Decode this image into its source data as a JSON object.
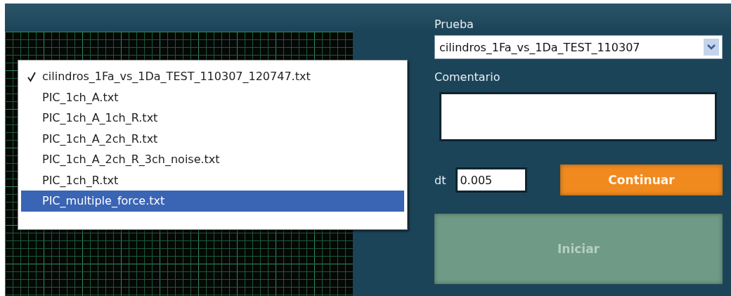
{
  "plot": {
    "dropdown_menu": {
      "items": [
        {
          "label": "cilindros_1Fa_vs_1Da_TEST_110307_120747.txt",
          "checked": true,
          "selected": false
        },
        {
          "label": "PIC_1ch_A.txt",
          "checked": false,
          "selected": false
        },
        {
          "label": "PIC_1ch_A_1ch_R.txt",
          "checked": false,
          "selected": false
        },
        {
          "label": "PIC_1ch_A_2ch_R.txt",
          "checked": false,
          "selected": false
        },
        {
          "label": "PIC_1ch_A_2ch_R_3ch_noise.txt",
          "checked": false,
          "selected": false
        },
        {
          "label": "PIC_1ch_R.txt",
          "checked": false,
          "selected": false
        },
        {
          "label": "PIC_multiple_force.txt",
          "checked": false,
          "selected": true
        }
      ]
    }
  },
  "panel": {
    "prueba": {
      "label": "Prueba",
      "value": "cilindros_1Fa_vs_1Da_TEST_110307"
    },
    "comentario": {
      "label": "Comentario"
    },
    "dt": {
      "label": "dt",
      "value": "0.005"
    },
    "continuar": {
      "label": "Continuar",
      "disabled": false
    },
    "iniciar": {
      "label": "Iniciar",
      "disabled": true
    }
  }
}
